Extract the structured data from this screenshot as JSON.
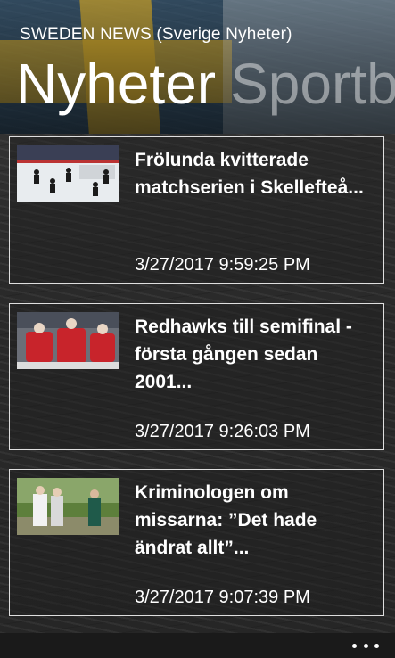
{
  "app": {
    "title": "SWEDEN NEWS (Sverige Nyheter)"
  },
  "pivot": {
    "active": "Nyheter",
    "next": "Sportbl"
  },
  "articles": [
    {
      "headline": "Frölunda kvitterade matchserien i Skellefteå...",
      "time": "3/27/2017 9:59:25 PM",
      "thumb": "hockey-game-photo"
    },
    {
      "headline": "Redhawks till semifinal - första gången sedan 2001...",
      "time": "3/27/2017 9:26:03 PM",
      "thumb": "hockey-players-celebrating-photo"
    },
    {
      "headline": "Kriminologen om missarna: ”Det hade ändrat allt”...",
      "time": "3/27/2017 9:07:39 PM",
      "thumb": "people-outdoors-photo"
    }
  ],
  "appbar": {
    "more_icon": "ellipsis-icon"
  },
  "colors": {
    "flag_blue": "#2f5d84",
    "flag_yellow": "#c9a12a",
    "card_border": "#ffffff",
    "appbar": "#1a1a1a"
  }
}
